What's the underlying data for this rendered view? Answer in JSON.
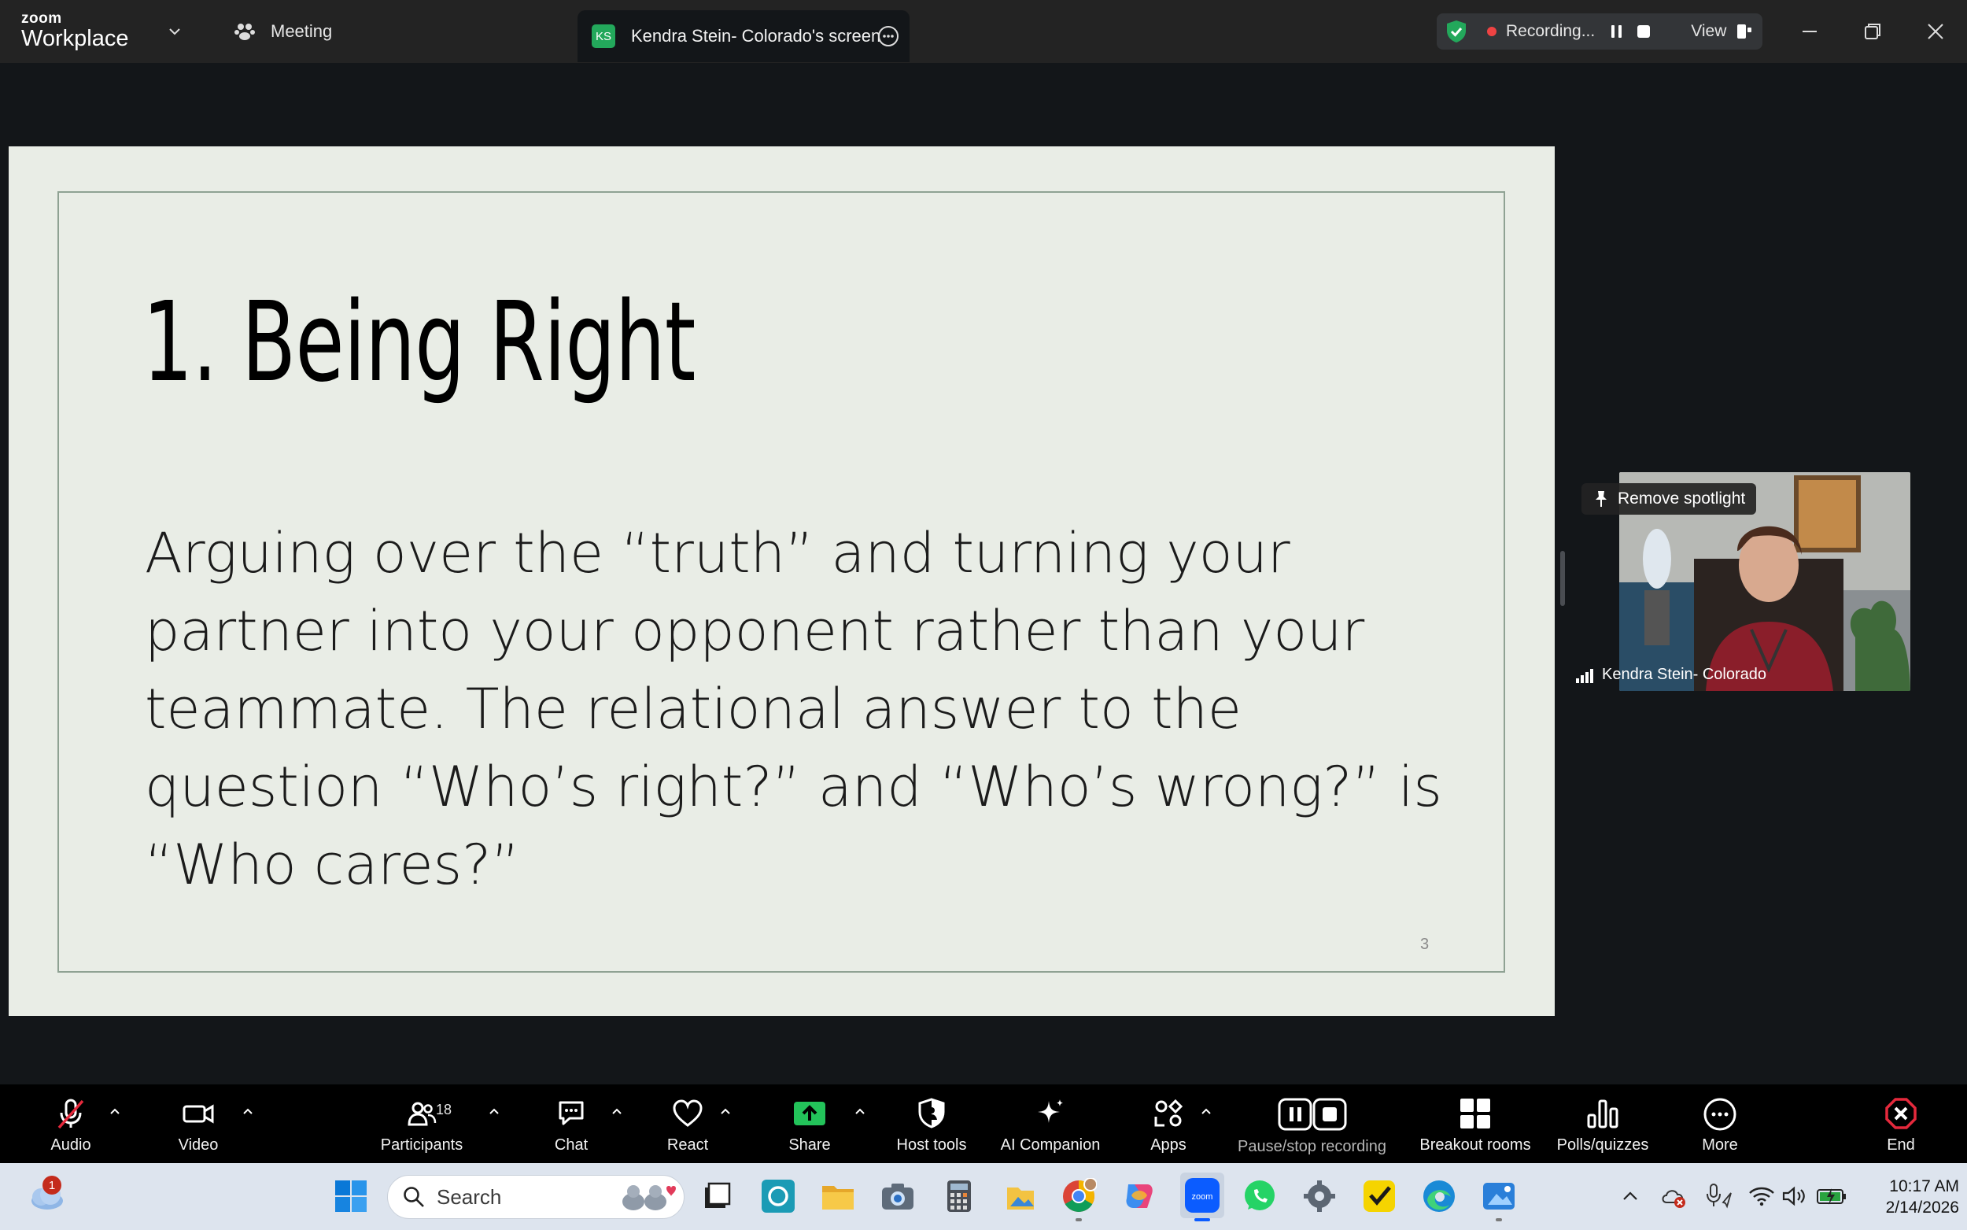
{
  "app": {
    "brand_small": "zoom",
    "brand_big": "Workplace",
    "meeting_tab": "Meeting"
  },
  "share_tab": {
    "initials": "KS",
    "label": "Kendra Stein- Colorado's screen"
  },
  "recording": {
    "status": "Recording...",
    "view_label": "View"
  },
  "slide": {
    "title": "1. Being Right",
    "body": "Arguing over the “truth” and turning your partner into your opponent rather than your teammate. The relational answer to the question “Who’s right?” and “Who’s wrong?” is “Who cares?”",
    "page_number": "3"
  },
  "speaker": {
    "spotlight_label": "Remove spotlight",
    "name": "Kendra Stein- Colorado"
  },
  "toolbar": {
    "audio": "Audio",
    "video": "Video",
    "participants": "Participants",
    "participants_count": "18",
    "chat": "Chat",
    "react": "React",
    "share": "Share",
    "host_tools": "Host tools",
    "ai_companion": "AI Companion",
    "apps": "Apps",
    "pause_stop": "Pause/stop recording",
    "breakout": "Breakout rooms",
    "polls": "Polls/quizzes",
    "more": "More",
    "end": "End"
  },
  "taskbar": {
    "search_placeholder": "Search",
    "weather_badge": "1",
    "time": "10:17 AM",
    "date": "2/14/2026"
  },
  "colors": {
    "accent_green": "#23a85b",
    "recording_red": "#ef4343",
    "end_red": "#e5293c",
    "slide_bg": "#e9ede6"
  }
}
